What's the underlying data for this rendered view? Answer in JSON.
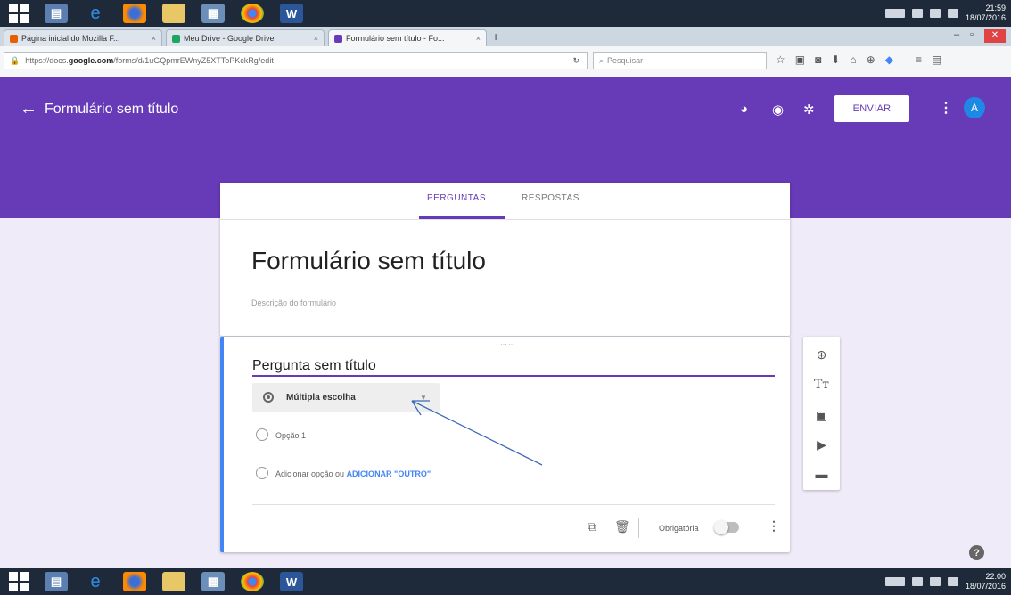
{
  "taskbar": {
    "word_label": "W",
    "top_time": "21:59",
    "top_date": "18/07/2016",
    "bottom_time": "22:00",
    "bottom_date": "18/07/2016"
  },
  "browser": {
    "tabs": [
      {
        "label": "Página inicial do Mozilla F...",
        "close": "×"
      },
      {
        "label": "Meu Drive - Google Drive",
        "close": "×"
      },
      {
        "label": "Formulário sem título - Fo...",
        "close": "×"
      }
    ],
    "new_tab": "+",
    "url_prefix": "https://docs.",
    "url_domain": "google.com",
    "url_rest": "/forms/d/1uGQpmrEWnyZ5XTToPKckRg/edit",
    "search_placeholder": "Pesquisar",
    "window_min": "–",
    "window_restore": "▫",
    "window_close": "✕"
  },
  "header": {
    "back": "←",
    "title": "Formulário sem título",
    "send_label": "ENVIAR",
    "avatar_letter": "A",
    "color": "#673ab7"
  },
  "form": {
    "tab_questions": "PERGUNTAS",
    "tab_responses": "RESPOSTAS",
    "title": "Formulário sem título",
    "description": "Descrição do formulário"
  },
  "question": {
    "title": "Pergunta sem título",
    "type_label": "Múltipla escolha",
    "option_1": "Opção 1",
    "add_option": "Adicionar opção",
    "add_or": " ou ",
    "add_other": "ADICIONAR \"OUTRO\"",
    "required_label": "Obrigatória",
    "required_on": false
  }
}
